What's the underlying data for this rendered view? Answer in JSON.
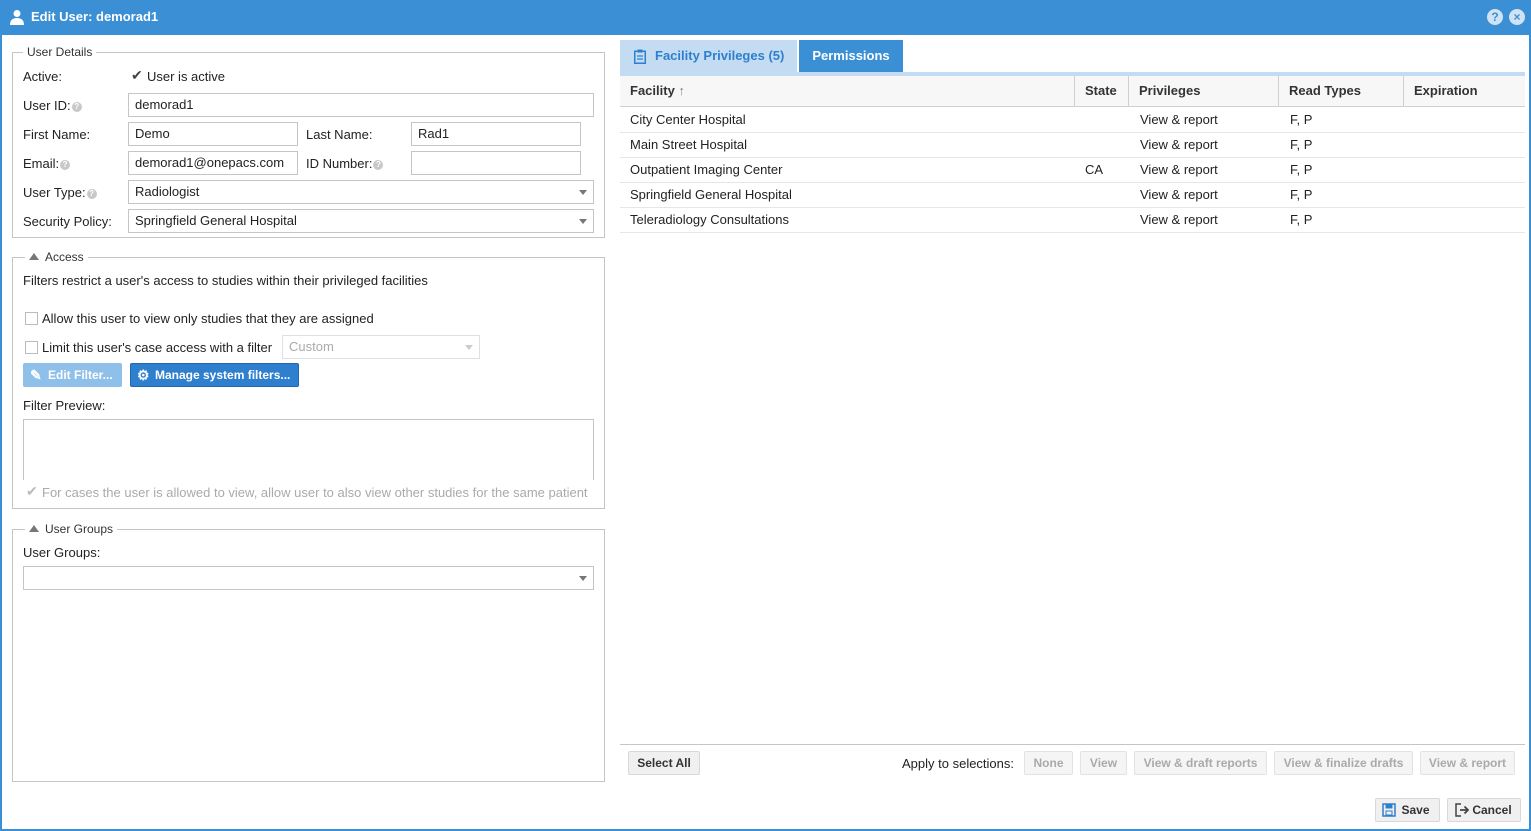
{
  "window": {
    "title": "Edit User: demorad1",
    "help_label": "?",
    "close_label": "×"
  },
  "user_details": {
    "legend": "User Details",
    "active_label": "Active:",
    "active_checkbox_label": "User is active",
    "active_checked": true,
    "user_id_label": "User ID:",
    "user_id_value": "demorad1",
    "first_name_label": "First Name:",
    "first_name_value": "Demo",
    "last_name_label": "Last Name:",
    "last_name_value": "Rad1",
    "email_label": "Email:",
    "email_value": "demorad1@onepacs.com",
    "id_number_label": "ID Number:",
    "id_number_value": "",
    "user_type_label": "User Type:",
    "user_type_value": "Radiologist",
    "security_policy_label": "Security Policy:",
    "security_policy_value": "Springfield General Hospital"
  },
  "access": {
    "legend": "Access",
    "description": "Filters restrict a user's access to studies within their privileged facilities",
    "assigned_only_label": "Allow this user to view only studies that they are assigned",
    "assigned_only_checked": false,
    "limit_filter_label": "Limit this user's case access with a filter",
    "limit_filter_checked": false,
    "filter_select_value": "Custom",
    "edit_filter_button": "Edit Filter...",
    "manage_filters_button": "Manage system filters...",
    "filter_preview_label": "Filter Preview:",
    "filter_preview_value": "",
    "same_patient_label": "For cases the user is allowed to view, allow user to also view other studies for the same patient",
    "same_patient_checked": true
  },
  "user_groups": {
    "legend": "User Groups",
    "field_label": "User Groups:",
    "value": ""
  },
  "tabs": [
    {
      "label": "Facility Privileges (5)",
      "active": true
    },
    {
      "label": "Permissions",
      "active": false
    }
  ],
  "grid": {
    "columns": [
      "Facility",
      "State",
      "Privileges",
      "Read Types",
      "Expiration"
    ],
    "sort_indicator": "↑",
    "rows": [
      {
        "facility": "City Center Hospital",
        "state": "",
        "privileges": "View & report",
        "read_types": "F, P",
        "expiration": ""
      },
      {
        "facility": "Main Street Hospital",
        "state": "",
        "privileges": "View & report",
        "read_types": "F, P",
        "expiration": ""
      },
      {
        "facility": "Outpatient Imaging Center",
        "state": "CA",
        "privileges": "View & report",
        "read_types": "F, P",
        "expiration": ""
      },
      {
        "facility": "Springfield General Hospital",
        "state": "",
        "privileges": "View & report",
        "read_types": "F, P",
        "expiration": ""
      },
      {
        "facility": "Teleradiology Consultations",
        "state": "",
        "privileges": "View & report",
        "read_types": "F, P",
        "expiration": ""
      }
    ]
  },
  "bottom_toolbar": {
    "select_all": "Select All",
    "apply_label": "Apply to selections:",
    "apply_buttons": [
      "None",
      "View",
      "View & draft reports",
      "View & finalize drafts",
      "View & report"
    ]
  },
  "footer": {
    "save": "Save",
    "cancel": "Cancel"
  },
  "colors": {
    "accent": "#3b8fd4",
    "button_blue": "#2e7fce",
    "tab_active_bg": "#c3dcf2"
  }
}
